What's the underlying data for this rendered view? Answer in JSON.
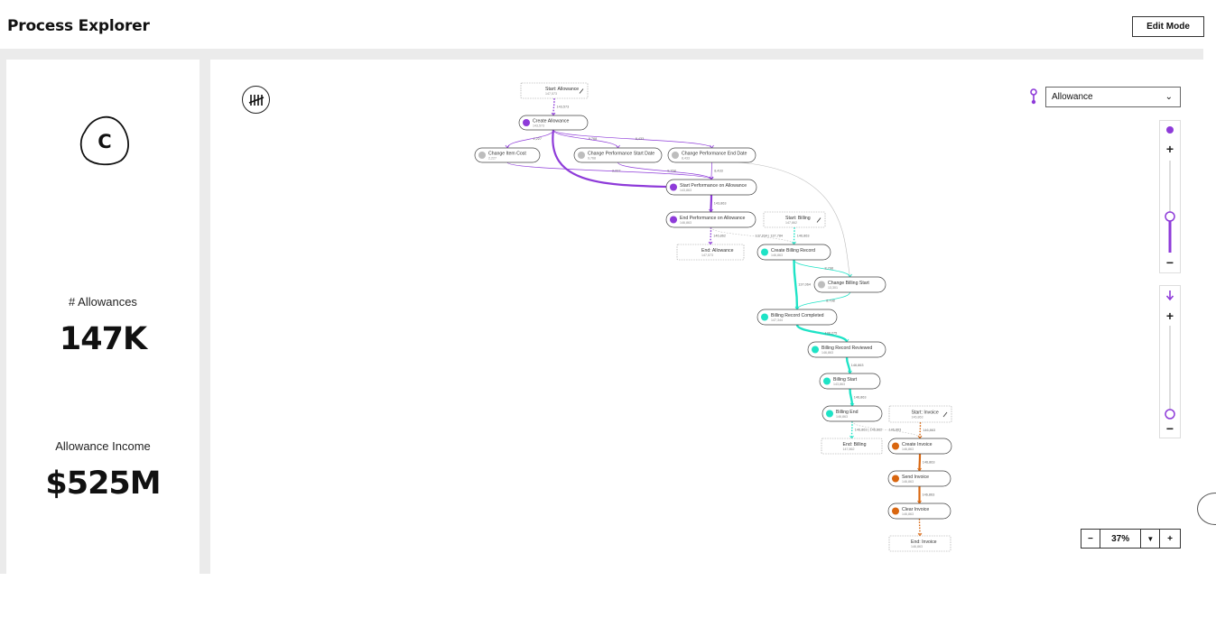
{
  "app": {
    "title": "Process Explorer",
    "edit_mode_label": "Edit Mode"
  },
  "kpis": {
    "logo_letter": "C",
    "allowances": {
      "label": "# Allowances",
      "value": "147K"
    },
    "income": {
      "label": "Allowance Income",
      "value": "$525M"
    }
  },
  "selector": {
    "value": "Allowance"
  },
  "zoom": {
    "minus": "−",
    "value": "37%",
    "plus": "+"
  },
  "sliders": {
    "plus": "+",
    "minus": "−"
  },
  "colors": {
    "allowance": "#8e3bd9",
    "billing": "#1ee3c6",
    "invoice": "#d9660f",
    "neutral": "#bdbdbd"
  },
  "process_map": {
    "nodes": [
      {
        "id": "start_allowance",
        "label": "Start: Allowance",
        "count": "147,573"
      },
      {
        "id": "create_allowance",
        "label": "Create Allowance",
        "count": "143,573"
      },
      {
        "id": "change_item_cost",
        "label": "Change Item Cost",
        "count": "2,227"
      },
      {
        "id": "change_perf_start",
        "label": "Change Performance Start Date",
        "count": "9,768"
      },
      {
        "id": "change_perf_end",
        "label": "Change Performance End Date",
        "count": "8,433"
      },
      {
        "id": "start_perf",
        "label": "Start Performance on Allowance",
        "count": "143,863"
      },
      {
        "id": "end_perf",
        "label": "End Performance on Allowance",
        "count": "146,863"
      },
      {
        "id": "start_billing",
        "label": "Start: Billing",
        "count": "147,862"
      },
      {
        "id": "end_allowance",
        "label": "End: Allowance",
        "count": "147,573"
      },
      {
        "id": "create_billing",
        "label": "Create Billing Record",
        "count": "146,863"
      },
      {
        "id": "change_billing_start",
        "label": "Change Billing Start",
        "count": "13,301"
      },
      {
        "id": "billing_completed",
        "label": "Billing Record Completed",
        "count": "147,344"
      },
      {
        "id": "billing_reviewed",
        "label": "Billing Record Reviewed",
        "count": "146,863"
      },
      {
        "id": "billing_start",
        "label": "Billing Start",
        "count": "143,863"
      },
      {
        "id": "billing_end",
        "label": "Billing End",
        "count": "146,863"
      },
      {
        "id": "start_invoice",
        "label": "Start: Invoice",
        "count": "146,863"
      },
      {
        "id": "end_billing",
        "label": "End: Billing",
        "count": "147,862"
      },
      {
        "id": "create_invoice",
        "label": "Create Invoice",
        "count": "146,863"
      },
      {
        "id": "send_invoice",
        "label": "Send Invoice",
        "count": "146,863"
      },
      {
        "id": "clear_invoice",
        "label": "Clear Invoice",
        "count": "146,863"
      },
      {
        "id": "end_invoice",
        "label": "End: Invoice",
        "count": "146,863"
      }
    ],
    "edge_labels": [
      "143,573",
      "2,227",
      "9,768",
      "8,433",
      "131,752",
      "2,227",
      "9,768",
      "8,433",
      "143,863",
      "146,862",
      "8,798 | 8,792",
      "137,034 | 137,784",
      "146,863",
      "8,798",
      "137,064",
      "8,798",
      "138,275",
      "146,863",
      "146,863",
      "146,863 | 146,862",
      "146,863",
      "146,863",
      "146,863",
      "146,863"
    ]
  }
}
